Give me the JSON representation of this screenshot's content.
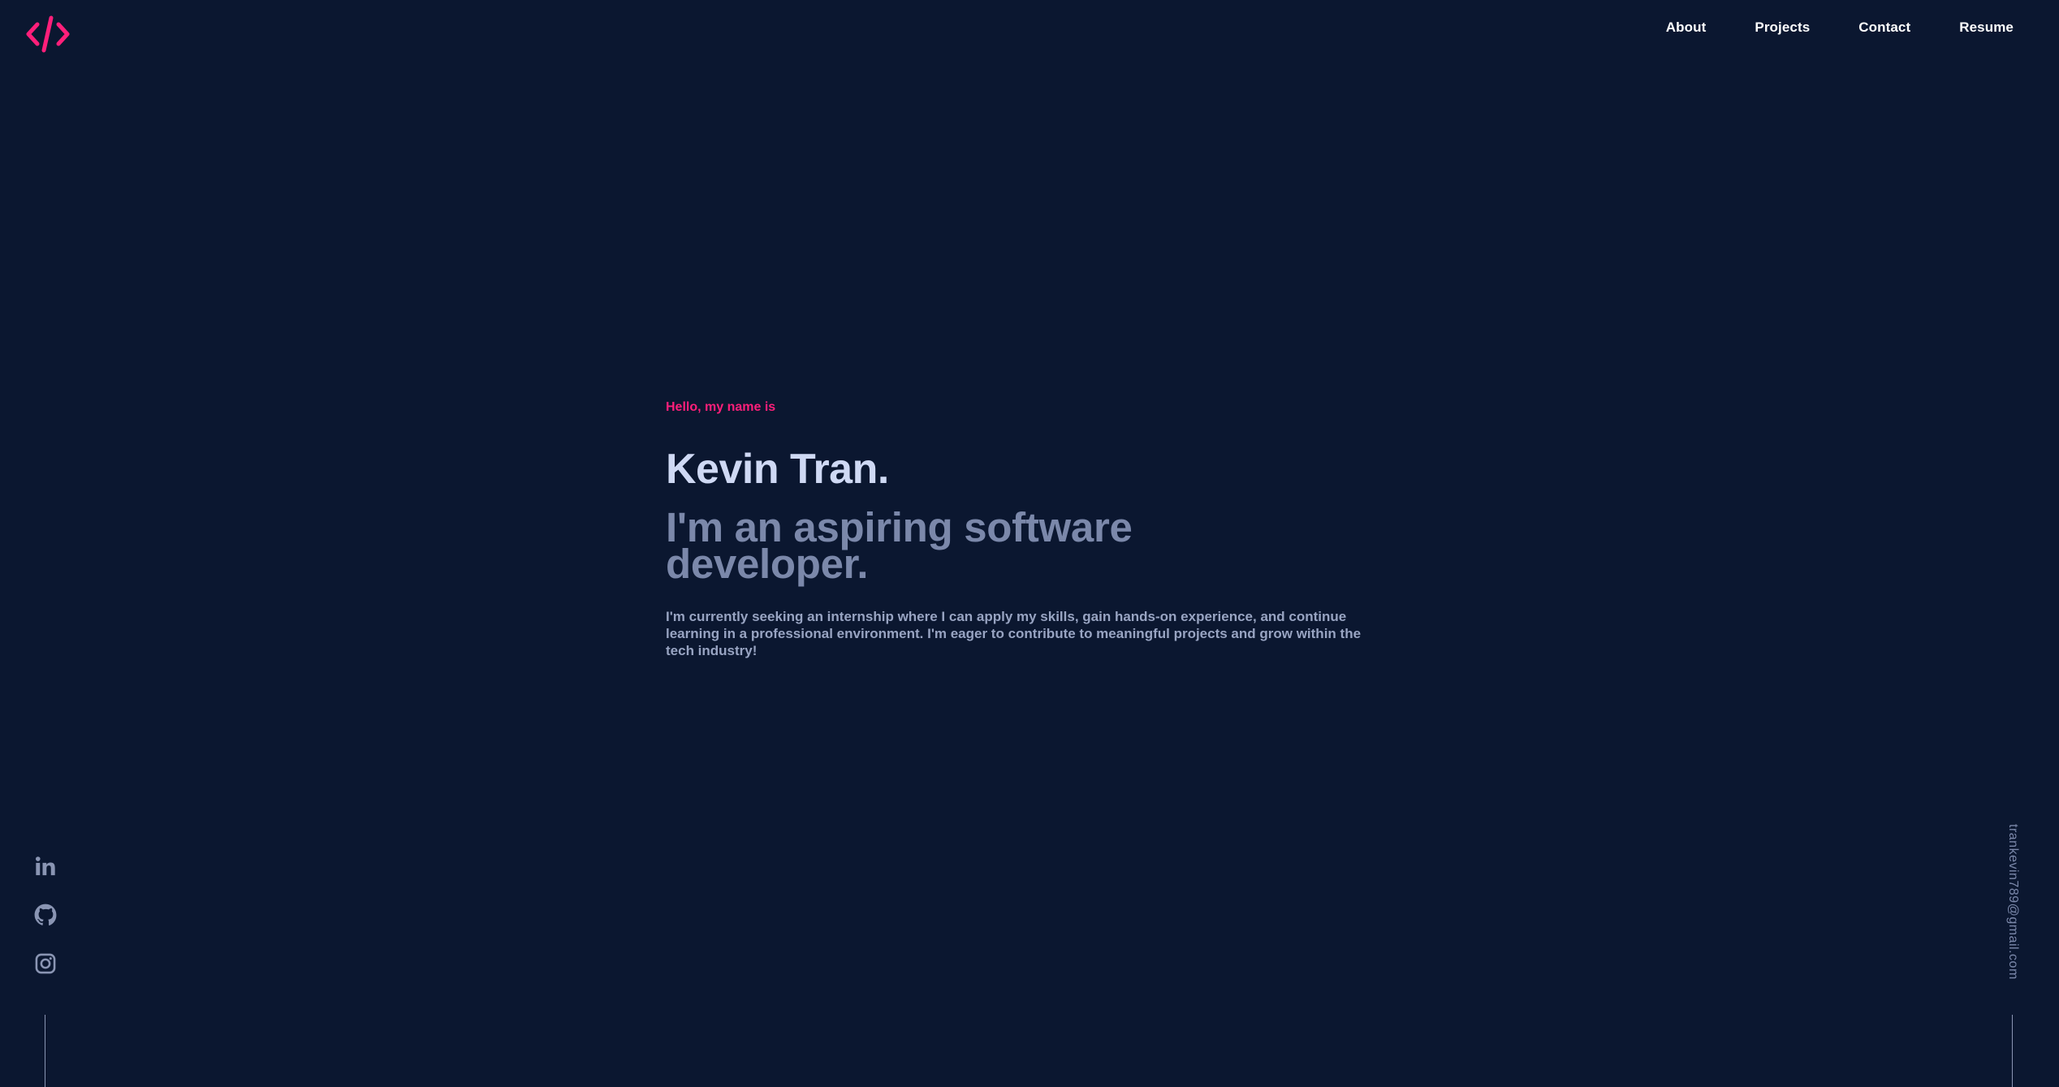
{
  "brand": {
    "logo_icon": "code-brackets-icon",
    "accent_color": "#ff1f7a"
  },
  "nav": {
    "items": [
      {
        "label": "About"
      },
      {
        "label": "Projects"
      },
      {
        "label": "Contact"
      },
      {
        "label": "Resume"
      }
    ]
  },
  "hero": {
    "greeting": "Hello, my name is",
    "name": "Kevin Tran.",
    "tagline": "I'm an aspiring software developer.",
    "description": "I'm currently seeking an internship where I can apply my skills, gain hands-on experience, and continue learning in a professional environment. I'm eager to contribute to meaningful projects and grow within the tech industry!"
  },
  "social": {
    "icons": [
      "linkedin-icon",
      "github-icon",
      "instagram-icon"
    ]
  },
  "contact": {
    "email": "trankevin789@gmail.com"
  },
  "colors": {
    "background": "#0b1730",
    "name": "#cfd9f4",
    "tagline": "#7b88aa",
    "body_text": "#98a4c2"
  }
}
